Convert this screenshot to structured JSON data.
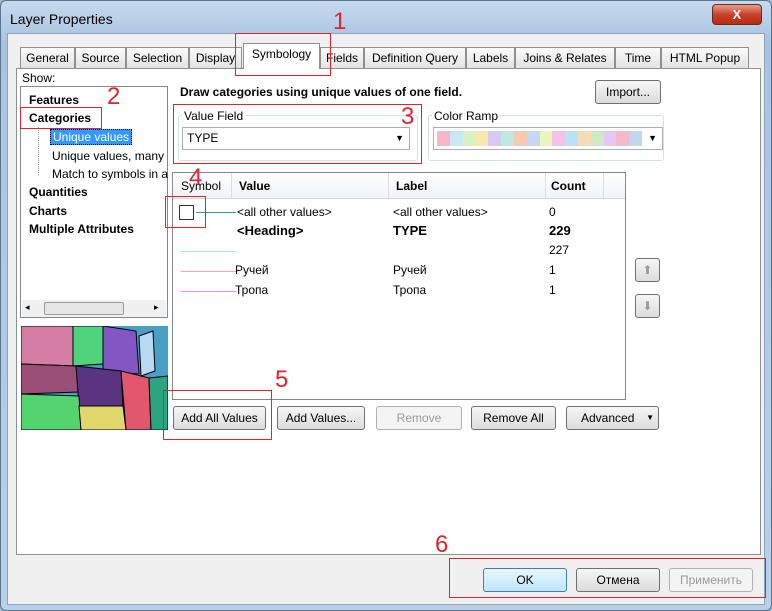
{
  "window": {
    "title": "Layer Properties",
    "close": "X"
  },
  "tabs": [
    "General",
    "Source",
    "Selection",
    "Display",
    "Symbology",
    "Fields",
    "Definition Query",
    "Labels",
    "Joins & Relates",
    "Time",
    "HTML Popup"
  ],
  "show": {
    "label": "Show:",
    "items": [
      "Features",
      "Categories",
      "Unique values",
      "Unique values, many",
      "Match to symbols in a",
      "Quantities",
      "Charts",
      "Multiple Attributes"
    ]
  },
  "main": {
    "description": "Draw categories using unique values of one field.",
    "import": "Import...",
    "value_field": {
      "label": "Value Field",
      "value": "TYPE"
    },
    "color_ramp": {
      "label": "Color Ramp",
      "colors": [
        "#f4b6c8",
        "#c9e7f5",
        "#d9f2c2",
        "#f9e7b0",
        "#d8c9f1",
        "#bfe9e0",
        "#f7c9b0",
        "#c7d6f7",
        "#e9f5b9",
        "#f3c2e9",
        "#b9e2f2",
        "#f5dcb8",
        "#cfe9c6",
        "#e4c8f3",
        "#f7b9c7",
        "#c0d8ef"
      ]
    },
    "table": {
      "headers": [
        "Symbol",
        "Value",
        "Label",
        "Count"
      ],
      "rows": [
        {
          "symbol": "#2aa5a5",
          "value": "<all other values>",
          "label": "<all other values>",
          "count": "0"
        },
        {
          "symbol": "",
          "value": "<Heading>",
          "label": "TYPE",
          "count": "229"
        },
        {
          "symbol": "#a8e6e0",
          "value": "",
          "label": "",
          "count": "227"
        },
        {
          "symbol": "#f0a8a8",
          "value": "Ручей",
          "label": "Ручей",
          "count": "1"
        },
        {
          "symbol": "#f090f0",
          "value": "Тропа",
          "label": "Тропа",
          "count": "1"
        }
      ]
    },
    "buttons": {
      "add_all": "Add All Values",
      "add": "Add Values...",
      "remove": "Remove",
      "remove_all": "Remove All",
      "advanced": "Advanced"
    }
  },
  "footer": {
    "ok": "OK",
    "cancel": "Отмена",
    "apply": "Применить"
  },
  "annotations": [
    "1",
    "2",
    "3",
    "4",
    "5",
    "6"
  ]
}
